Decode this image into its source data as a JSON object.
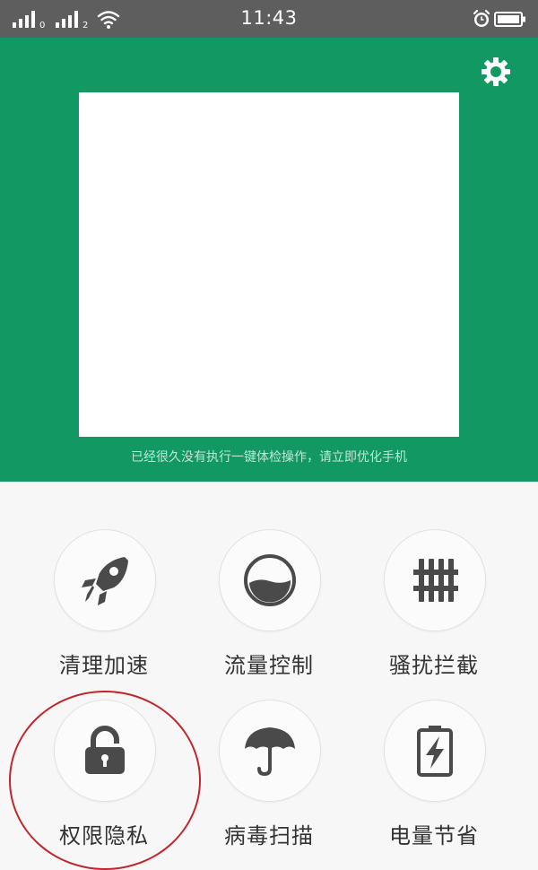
{
  "status_bar": {
    "time": "11:43",
    "sim1_label": "",
    "sim2_label": "",
    "icons": [
      "signal-icon",
      "signal-icon",
      "wifi-icon",
      "alarm-icon",
      "battery-icon"
    ]
  },
  "header": {
    "hint": "已经很久没有执行一键体检操作，请立即优化手机",
    "bg_color": "#129963"
  },
  "tools": [
    {
      "label": "清理加速",
      "icon": "rocket-icon"
    },
    {
      "label": "流量控制",
      "icon": "data-gauge-icon"
    },
    {
      "label": "骚扰拦截",
      "icon": "fence-icon"
    },
    {
      "label": "权限隐私",
      "icon": "lock-icon"
    },
    {
      "label": "病毒扫描",
      "icon": "umbrella-icon"
    },
    {
      "label": "电量节省",
      "icon": "battery-charge-icon"
    }
  ],
  "annotation_color": "#c0272d"
}
